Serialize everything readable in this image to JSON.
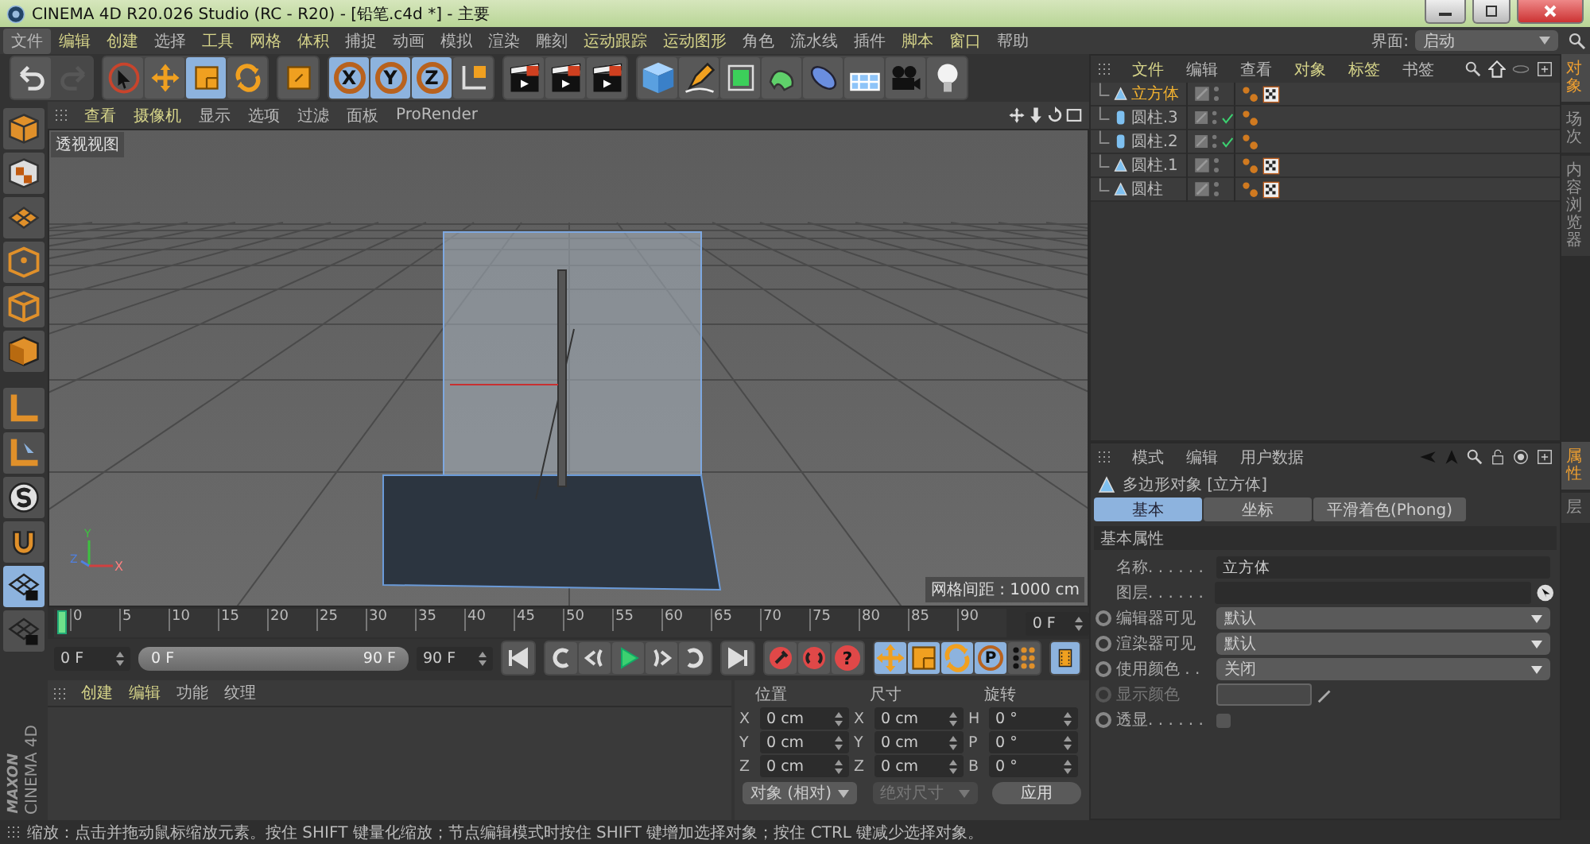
{
  "window": {
    "title": "CINEMA 4D R20.026 Studio (RC - R20) - [铅笔.c4d *] - 主要"
  },
  "menu": [
    {
      "label": "文件",
      "selected": true,
      "highlighted": false
    },
    {
      "label": "编辑",
      "selected": false,
      "highlighted": true
    },
    {
      "label": "创建",
      "selected": false,
      "highlighted": true
    },
    {
      "label": "选择",
      "selected": false,
      "highlighted": false
    },
    {
      "label": "工具",
      "selected": false,
      "highlighted": true
    },
    {
      "label": "网格",
      "selected": false,
      "highlighted": true
    },
    {
      "label": "体积",
      "selected": false,
      "highlighted": true
    },
    {
      "label": "捕捉",
      "selected": false,
      "highlighted": false
    },
    {
      "label": "动画",
      "selected": false,
      "highlighted": false
    },
    {
      "label": "模拟",
      "selected": false,
      "highlighted": false
    },
    {
      "label": "渲染",
      "selected": false,
      "highlighted": false
    },
    {
      "label": "雕刻",
      "selected": false,
      "highlighted": false
    },
    {
      "label": "运动跟踪",
      "selected": false,
      "highlighted": true
    },
    {
      "label": "运动图形",
      "selected": false,
      "highlighted": true
    },
    {
      "label": "角色",
      "selected": false,
      "highlighted": false
    },
    {
      "label": "流水线",
      "selected": false,
      "highlighted": false
    },
    {
      "label": "插件",
      "selected": false,
      "highlighted": false
    },
    {
      "label": "脚本",
      "selected": false,
      "highlighted": true
    },
    {
      "label": "窗口",
      "selected": false,
      "highlighted": true
    },
    {
      "label": "帮助",
      "selected": false,
      "highlighted": false
    }
  ],
  "layout": {
    "label": "界面:",
    "value": "启动"
  },
  "toolbar": [
    [
      {
        "kind": "undo",
        "selected": false,
        "disabled": false
      },
      {
        "kind": "redo",
        "selected": false,
        "disabled": true
      }
    ],
    [
      {
        "kind": "select",
        "selected": false,
        "disabled": false
      },
      {
        "kind": "move",
        "selected": false,
        "disabled": false
      },
      {
        "kind": "scale",
        "selected": true,
        "disabled": false
      },
      {
        "kind": "rotate",
        "selected": false,
        "disabled": false
      }
    ],
    [
      {
        "kind": "tool",
        "selected": false,
        "disabled": false
      }
    ],
    [
      {
        "kind": "axis",
        "label": "X",
        "selected": true,
        "disabled": false
      },
      {
        "kind": "axis",
        "label": "Y",
        "selected": true,
        "disabled": false
      },
      {
        "kind": "axis",
        "label": "Z",
        "selected": true,
        "disabled": false
      },
      {
        "kind": "coords",
        "selected": false,
        "disabled": false
      }
    ],
    [
      {
        "kind": "render",
        "selected": false,
        "disabled": false
      },
      {
        "kind": "render",
        "selected": false,
        "disabled": false
      },
      {
        "kind": "render",
        "selected": false,
        "disabled": false
      }
    ],
    [
      {
        "kind": "cube",
        "selected": false,
        "disabled": false
      },
      {
        "kind": "pen",
        "selected": false,
        "disabled": false
      },
      {
        "kind": "subdivide",
        "selected": false,
        "disabled": false
      },
      {
        "kind": "deform",
        "selected": false,
        "disabled": false
      },
      {
        "kind": "capsule",
        "selected": false,
        "disabled": false
      },
      {
        "kind": "floor",
        "selected": false,
        "disabled": false
      },
      {
        "kind": "camera",
        "selected": false,
        "disabled": false
      },
      {
        "kind": "light",
        "selected": false,
        "disabled": false
      }
    ]
  ],
  "left_tools": [
    {
      "kind": "model",
      "selected": false
    },
    {
      "kind": "texture",
      "selected": false
    },
    {
      "kind": "layers",
      "selected": false
    },
    {
      "kind": "points",
      "selected": false
    },
    {
      "kind": "edges",
      "selected": false
    },
    {
      "kind": "polygons",
      "selected": false
    },
    {
      "kind": "workplane",
      "selected": false
    },
    {
      "kind": "tweak",
      "selected": false
    },
    {
      "kind": "snap",
      "selected": false
    },
    {
      "kind": "magnet",
      "selected": false
    },
    {
      "kind": "lock",
      "selected": true
    },
    {
      "kind": "lock",
      "selected": false
    }
  ],
  "viewport": {
    "menu": [
      {
        "label": "查看",
        "highlighted": true
      },
      {
        "label": "摄像机",
        "highlighted": true
      },
      {
        "label": "显示",
        "highlighted": false
      },
      {
        "label": "选项",
        "highlighted": false
      },
      {
        "label": "过滤",
        "highlighted": false
      },
      {
        "label": "面板",
        "highlighted": false
      },
      {
        "label": "ProRender",
        "highlighted": false
      }
    ],
    "view_name": "透视视图",
    "grid_spacing": "网格间距 : 1000 cm",
    "axes": [
      "Y",
      "X",
      "Z"
    ]
  },
  "timeline": {
    "ticks": [
      "0",
      "5",
      "10",
      "15",
      "20",
      "25",
      "30",
      "35",
      "40",
      "45",
      "50",
      "55",
      "60",
      "65",
      "70",
      "75",
      "80",
      "85",
      "90"
    ],
    "playhead": {
      "level": 0
    },
    "current": "0 F"
  },
  "controls": {
    "start": "0 F",
    "range": {
      "from": "0 F",
      "to": "90 F",
      "level": 1
    },
    "end": "90 F",
    "transport": [
      {
        "kind": "first"
      },
      {
        "kind": "prev_key"
      },
      {
        "kind": "prev_frame"
      },
      {
        "kind": "play"
      },
      {
        "kind": "next_frame"
      },
      {
        "kind": "next_key"
      },
      {
        "kind": "last"
      }
    ],
    "keys": [
      {
        "kind": "record"
      },
      {
        "kind": "auto"
      },
      {
        "kind": "glyph",
        "label": "?"
      }
    ],
    "modes": [
      {
        "kind": "move",
        "selected": true
      },
      {
        "kind": "scale",
        "selected": true
      },
      {
        "kind": "rotate",
        "selected": true
      },
      {
        "kind": "glyph",
        "label": "P",
        "selected": true
      },
      {
        "kind": "dots",
        "selected": false
      }
    ]
  },
  "materials": {
    "menu": [
      {
        "label": "创建",
        "highlighted": true
      },
      {
        "label": "编辑",
        "highlighted": true
      },
      {
        "label": "功能",
        "highlighted": false
      },
      {
        "label": "纹理",
        "highlighted": false
      }
    ]
  },
  "coordinates": {
    "headers": [
      "位置",
      "尺寸",
      "旋转"
    ],
    "rows": [
      [
        {
          "axis": "X",
          "value": "0 cm"
        },
        {
          "axis": "X",
          "value": "0 cm"
        },
        {
          "axis": "H",
          "value": "0 °"
        }
      ],
      [
        {
          "axis": "Y",
          "value": "0 cm"
        },
        {
          "axis": "Y",
          "value": "0 cm"
        },
        {
          "axis": "P",
          "value": "0 °"
        }
      ],
      [
        {
          "axis": "Z",
          "value": "0 cm"
        },
        {
          "axis": "Z",
          "value": "0 cm"
        },
        {
          "axis": "B",
          "value": "0 °"
        }
      ]
    ],
    "mode": "对象 (相对)",
    "size_mode": {
      "label": "绝对尺寸",
      "disabled": true
    },
    "apply": "应用"
  },
  "logo": {
    "brand": "MAXON",
    "product": "CINEMA 4D"
  },
  "objects": {
    "menu": [
      {
        "label": "文件",
        "highlighted": true
      },
      {
        "label": "编辑",
        "highlighted": false
      },
      {
        "label": "查看",
        "highlighted": false
      },
      {
        "label": "对象",
        "highlighted": true
      },
      {
        "label": "标签",
        "highlighted": true
      },
      {
        "label": "书签",
        "highlighted": false
      }
    ],
    "items": [
      {
        "name": "立方体",
        "kind": "polygon",
        "selected": true,
        "checked": false,
        "texture_tag": true
      },
      {
        "name": "圆柱.3",
        "kind": "cylinder",
        "selected": false,
        "checked": true,
        "texture_tag": false
      },
      {
        "name": "圆柱.2",
        "kind": "cylinder",
        "selected": false,
        "checked": true,
        "texture_tag": false
      },
      {
        "name": "圆柱.1",
        "kind": "polygon",
        "selected": false,
        "checked": false,
        "texture_tag": true
      },
      {
        "name": "圆柱",
        "kind": "polygon",
        "selected": false,
        "checked": false,
        "texture_tag": true
      }
    ],
    "side_tabs": [
      {
        "label": "对象",
        "selected": true
      },
      {
        "label": "场次",
        "selected": false
      },
      {
        "label": "内容浏览器",
        "selected": false
      }
    ]
  },
  "attributes": {
    "menu": [
      "模式",
      "编辑",
      "用户数据"
    ],
    "object": "多边形对象 [立方体]",
    "tabs": [
      {
        "label": "基本",
        "selected": true
      },
      {
        "label": "坐标",
        "selected": false
      },
      {
        "label": "平滑着色(Phong)",
        "selected": false
      }
    ],
    "section": "基本属性",
    "fields": [
      {
        "kind": "text",
        "label": "名称. . . . . .",
        "value": "立方体",
        "animatable": false,
        "disabled": false
      },
      {
        "kind": "layer",
        "label": "图层. . . . . .",
        "animatable": false,
        "disabled": false
      },
      {
        "kind": "dropdown",
        "label": "编辑器可见",
        "value": "默认",
        "animatable": true,
        "disabled": false
      },
      {
        "kind": "dropdown",
        "label": "渲染器可见",
        "value": "默认",
        "animatable": true,
        "disabled": false
      },
      {
        "kind": "dropdown",
        "label": "使用颜色 . .",
        "value": "关闭",
        "animatable": true,
        "disabled": false
      },
      {
        "kind": "color",
        "label": "显示颜色",
        "animatable": true,
        "disabled": true
      },
      {
        "kind": "checkbox",
        "label": "透显. . . . . .",
        "checked": false,
        "animatable": true,
        "disabled": false
      }
    ],
    "side_tabs": [
      {
        "label": "属性",
        "selected": true
      },
      {
        "label": "层",
        "selected": false
      }
    ]
  },
  "status": "缩放：点击并拖动鼠标缩放元素。按住 SHIFT 键量化缩放；节点编辑模式时按住 SHIFT 键增加选择对象；按住 CTRL 键减少选择对象。"
}
